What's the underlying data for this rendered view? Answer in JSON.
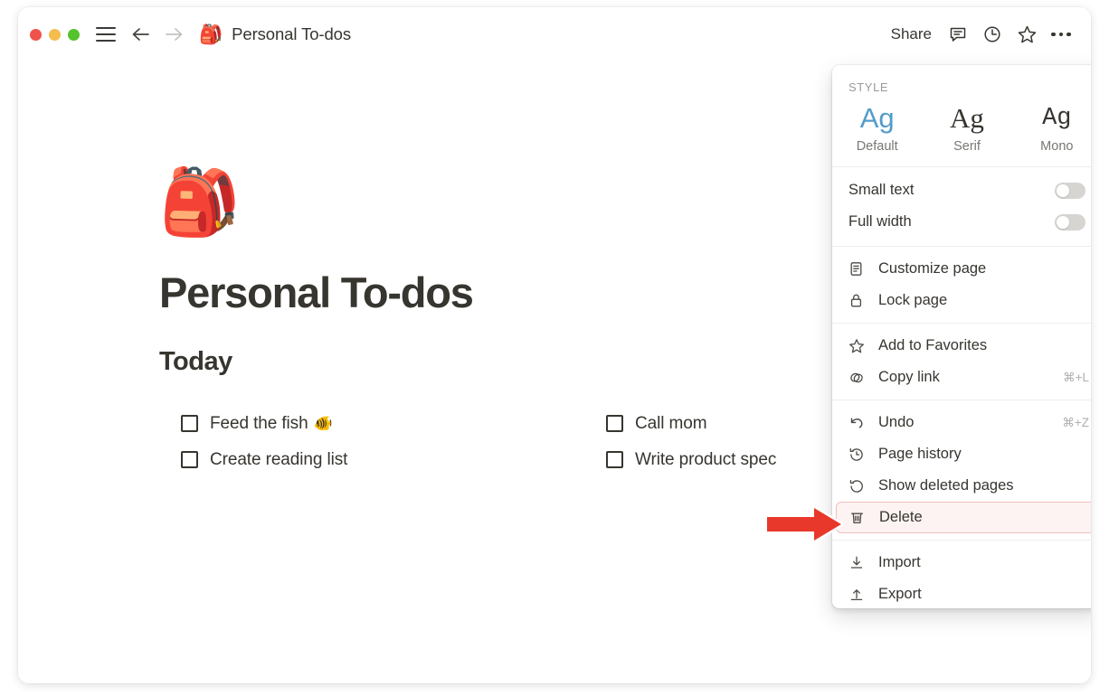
{
  "titlebar": {
    "window_controls": [
      "close",
      "minimize",
      "maximize"
    ],
    "menu_icon": "hamburger-icon",
    "back_icon": "arrow-left-icon",
    "forward_icon": "arrow-right-icon",
    "page_emoji": "🎒",
    "page_title": "Personal To-dos",
    "share_label": "Share",
    "comment_icon": "comment-icon",
    "history_icon": "clock-icon",
    "favorite_icon": "star-icon",
    "more_icon": "more-horizontal-icon"
  },
  "page": {
    "emoji": "🎒",
    "title": "Personal To-dos",
    "section_heading": "Today",
    "todos_left": [
      {
        "text": "Feed the fish",
        "emoji": "🐠",
        "checked": false
      },
      {
        "text": "Create reading list",
        "emoji": "",
        "checked": false
      }
    ],
    "todos_right": [
      {
        "text": "Call mom",
        "emoji": "",
        "checked": false
      },
      {
        "text": "Write product spec",
        "emoji": "",
        "checked": false
      }
    ]
  },
  "menu": {
    "style_label": "STYLE",
    "style_options": [
      {
        "sample": "Ag",
        "name": "Default",
        "active": true
      },
      {
        "sample": "Ag",
        "name": "Serif",
        "active": false
      },
      {
        "sample": "Ag",
        "name": "Mono",
        "active": false
      }
    ],
    "toggles": [
      {
        "label": "Small text",
        "on": false
      },
      {
        "label": "Full width",
        "on": false
      }
    ],
    "group_page": [
      {
        "label": "Customize page",
        "icon": "document-icon",
        "shortcut": ""
      },
      {
        "label": "Lock page",
        "icon": "lock-icon",
        "shortcut": ""
      }
    ],
    "group_share": [
      {
        "label": "Add to Favorites",
        "icon": "star-icon",
        "shortcut": ""
      },
      {
        "label": "Copy link",
        "icon": "link-icon",
        "shortcut": "⌘+L"
      }
    ],
    "group_history": [
      {
        "label": "Undo",
        "icon": "undo-icon",
        "shortcut": "⌘+Z"
      },
      {
        "label": "Page history",
        "icon": "clock-history-icon",
        "shortcut": ""
      },
      {
        "label": "Show deleted pages",
        "icon": "restore-icon",
        "shortcut": ""
      },
      {
        "label": "Delete",
        "icon": "trash-icon",
        "shortcut": "",
        "highlighted": true
      }
    ],
    "group_io": [
      {
        "label": "Import",
        "icon": "import-icon",
        "shortcut": ""
      },
      {
        "label": "Export",
        "icon": "export-icon",
        "shortcut": ""
      }
    ]
  },
  "annotation": {
    "arrow": "red-arrow-pointing-right",
    "target": "Delete"
  },
  "colors": {
    "accent_blue": "#529cca",
    "text_primary": "#37352f",
    "text_muted": "#9b9a97",
    "danger_border": "#f0c0bb",
    "danger_bg": "#fdf3f2",
    "annotation_red": "#e8382b",
    "traffic_red": "#f05349",
    "traffic_yellow": "#f4bd4e",
    "traffic_green": "#54c32c"
  }
}
